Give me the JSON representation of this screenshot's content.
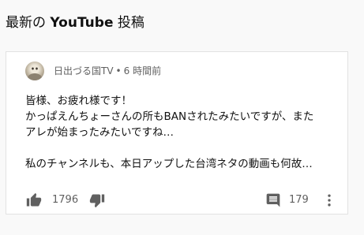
{
  "section": {
    "title_prefix": "最新の",
    "title_brand": "YouTube",
    "title_suffix": "投稿"
  },
  "post": {
    "channel_name": "日出づる国TV",
    "separator": "•",
    "time_ago": "6 時間前",
    "lines": [
      "皆様、お疲れ様です！",
      "かっぱえんちょーさんの所もBANされたみたいですが、また",
      "アレが始まったみたいですね…",
      "",
      "私のチャンネルも、本日アップした台湾ネタの動画も何故…"
    ],
    "like_count": "1796",
    "comment_count": "179"
  },
  "icons": {
    "like": "thumbs-up-icon",
    "dislike": "thumbs-down-icon",
    "comment": "comment-icon",
    "more": "more-vertical-icon"
  },
  "colors": {
    "icon": "#606060",
    "background": "#f9f9f9",
    "card": "#ffffff"
  }
}
